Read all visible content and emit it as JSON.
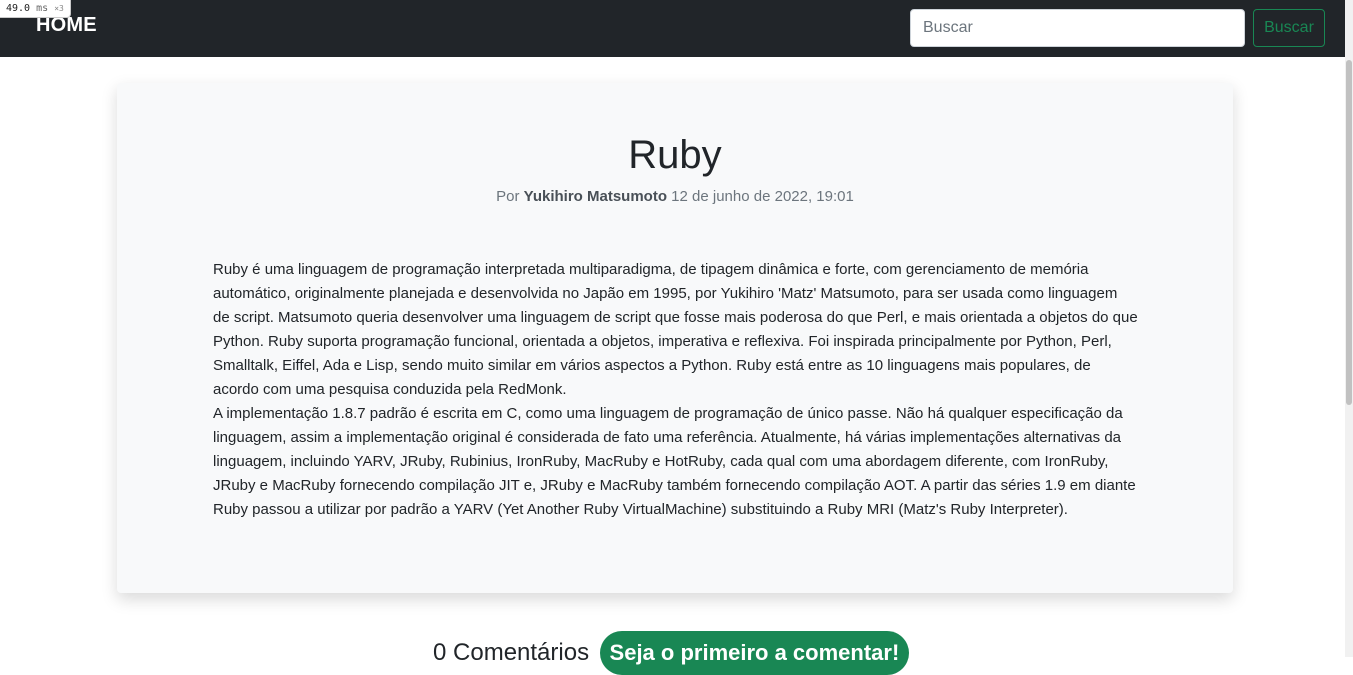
{
  "perf_overlay": {
    "value": "49.0",
    "unit": "ms",
    "multiplier": "×3"
  },
  "navbar": {
    "brand": "HOME",
    "search": {
      "placeholder": "Buscar",
      "value": "",
      "button_label": "Buscar"
    }
  },
  "post": {
    "title": "Ruby",
    "meta": {
      "by_prefix": "Por",
      "author": "Yukihiro Matsumoto",
      "date": "12 de junho de 2022, 19:01"
    },
    "paragraphs": [
      "Ruby é uma linguagem de programação interpretada multiparadigma, de tipagem dinâmica e forte, com gerenciamento de memória automático, originalmente planejada e desenvolvida no Japão em 1995, por Yukihiro 'Matz' Matsumoto, para ser usada como linguagem de script. Matsumoto queria desenvolver uma linguagem de script que fosse mais poderosa do que Perl, e mais orientada a objetos do que Python. Ruby suporta programação funcional, orientada a objetos, imperativa e reflexiva. Foi inspirada principalmente por Python, Perl, Smalltalk, Eiffel, Ada e Lisp, sendo muito similar em vários aspectos a Python. Ruby está entre as 10 linguagens mais populares, de acordo com uma pesquisa conduzida pela RedMonk.",
      "A implementação 1.8.7 padrão é escrita em C, como uma linguagem de programação de único passe. Não há qualquer especificação da linguagem, assim a implementação original é considerada de fato uma referência. Atualmente, há várias implementações alternativas da linguagem, incluindo YARV, JRuby, Rubinius, IronRuby, MacRuby e HotRuby, cada qual com uma abordagem diferente, com IronRuby, JRuby e MacRuby fornecendo compilação JIT e, JRuby e MacRuby também fornecendo compilação AOT. A partir das séries 1.9 em diante Ruby passou a utilizar por padrão a YARV (Yet Another Ruby VirtualMachine) substituindo a Ruby MRI (Matz's Ruby Interpreter)."
    ]
  },
  "comments": {
    "count_label": "0 Comentários",
    "first_comment_button": "Seja o primeiro a comentar!"
  },
  "colors": {
    "navbar_bg": "#212529",
    "accent_green": "#198754",
    "card_bg": "#f8f9fa"
  }
}
